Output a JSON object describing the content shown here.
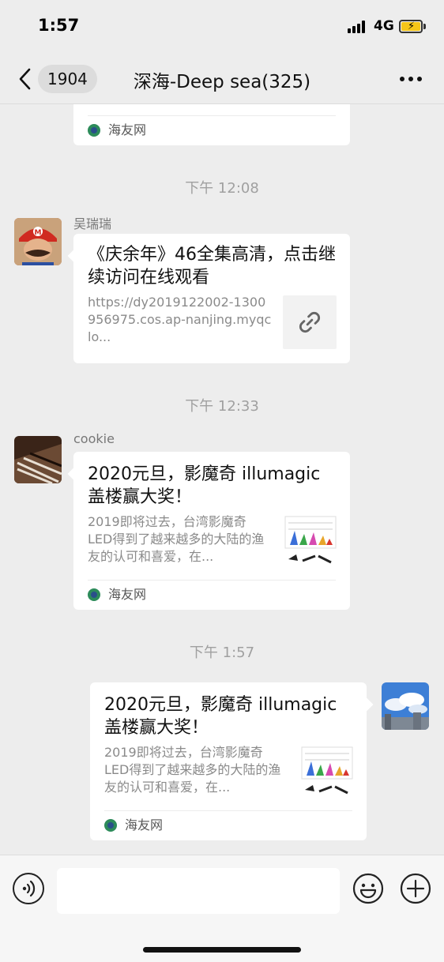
{
  "status_bar": {
    "time": "1:57",
    "network": "4G"
  },
  "nav": {
    "back_count": "1904",
    "title": "深海-Deep sea(325)"
  },
  "messages": {
    "top_card": {
      "source": "海友网"
    },
    "ts1": "下午 12:08",
    "m1": {
      "sender": "吴瑞瑞",
      "title": "《庆余年》46全集高清，点击继续访问在线观看",
      "url": "https://dy2019122002-1300956975.cos.ap-nanjing.myqclo..."
    },
    "ts2": "下午 12:33",
    "m2": {
      "sender": "cookie",
      "title": "2020元旦，影魔奇 illumagic 盖楼赢大奖！",
      "desc": "2019即将过去，台湾影魔奇LED得到了越来越多的大陆的渔友的认可和喜爱，在...",
      "source": "海友网"
    },
    "ts3": "下午 1:57",
    "m3": {
      "title": "2020元旦，影魔奇 illumagic 盖楼赢大奖！",
      "desc": "2019即将过去，台湾影魔奇LED得到了越来越多的大陆的渔友的认可和喜爱，在...",
      "source": "海友网"
    }
  },
  "icons": {
    "back": "chevron-left-icon",
    "more": "more-icon",
    "link": "link-icon",
    "voice": "voice-icon",
    "emoji": "emoji-icon",
    "plus": "plus-icon"
  }
}
